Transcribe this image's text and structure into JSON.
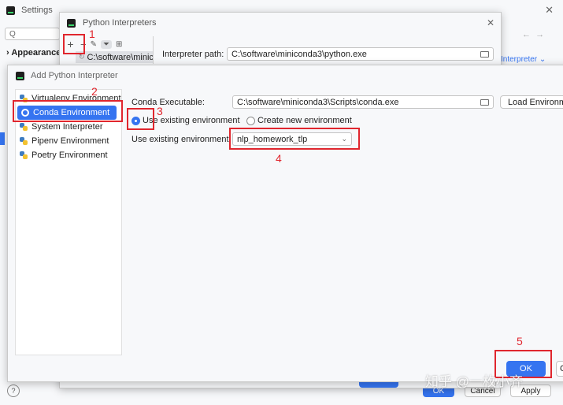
{
  "settings": {
    "title": "Settings",
    "search_placeholder": "Q",
    "nav_item": "Appearance",
    "right_link": "Interpreter",
    "ok_label": "OK",
    "cancel_label": "Cancel",
    "apply_label": "Apply",
    "help_label": "?"
  },
  "interpreters": {
    "title": "Python Interpreters",
    "list_item": "C:\\software\\minic",
    "path_label": "Interpreter path:",
    "path_value": "C:\\software\\miniconda3\\python.exe",
    "toolbar": [
      "add",
      "remove",
      "edit",
      "filter",
      "tree"
    ]
  },
  "add_dialog": {
    "title": "Add Python Interpreter",
    "left_nav": [
      {
        "label": "Virtualenv Environment"
      },
      {
        "label": "Conda Environment",
        "selected": true
      },
      {
        "label": "System Interpreter"
      },
      {
        "label": "Pipenv Environment"
      },
      {
        "label": "Poetry Environment"
      }
    ],
    "conda_exe_label": "Conda Executable:",
    "conda_exe_value": "C:\\software\\miniconda3\\Scripts\\conda.exe",
    "load_button": "Load Environm",
    "use_existing_radio": "Use existing environment",
    "create_new_radio": "Create new environment",
    "use_existing_label": "Use existing environment:",
    "selected_env": "nlp_homework_tlp",
    "ok_label": "OK",
    "cancel_label": "C"
  },
  "annotations": [
    "1",
    "2",
    "3",
    "4",
    "5"
  ],
  "watermark": "知乎 @一枚小齐",
  "colors": {
    "accent": "#3574f0",
    "annotation": "#e0262e"
  }
}
